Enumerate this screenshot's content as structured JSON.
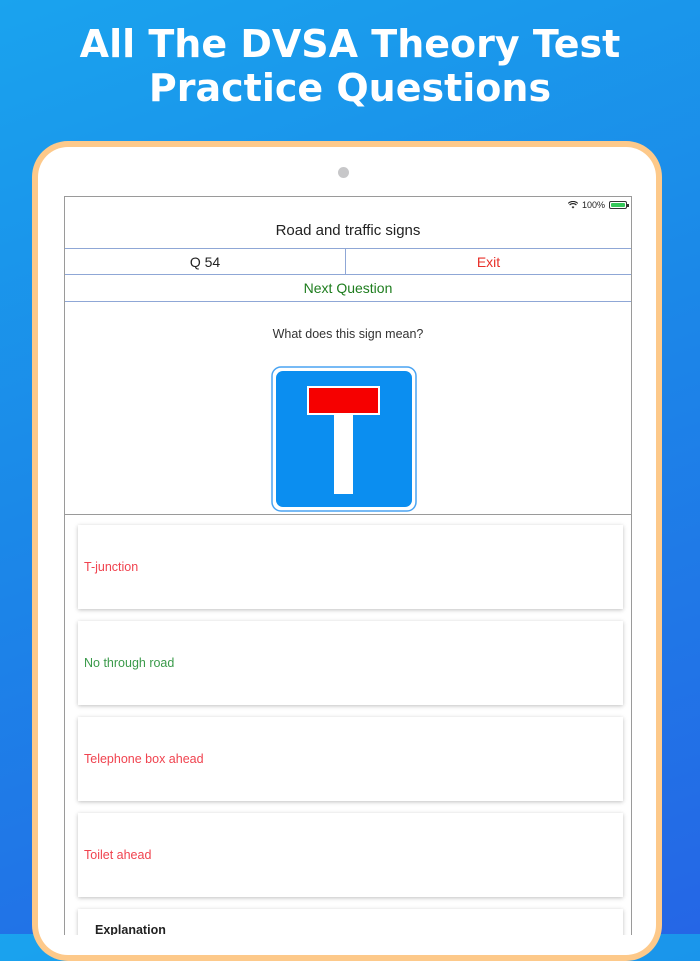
{
  "headline": {
    "line1": "All The DVSA Theory Test",
    "line2": "Practice Questions"
  },
  "status_bar": {
    "battery": "100%",
    "battery_level": 1.0,
    "icons": [
      "wifi-icon",
      "battery-icon"
    ]
  },
  "header": {
    "title": "Road and traffic signs",
    "question_number": "Q 54",
    "exit_label": "Exit",
    "next_label": "Next Question"
  },
  "question": {
    "text": "What does this sign mean?",
    "sign_icon": "no-through-road-sign-icon"
  },
  "answers": [
    {
      "label": "T-junction",
      "state": "wrong"
    },
    {
      "label": "No through road",
      "state": "correct"
    },
    {
      "label": "Telephone box ahead",
      "state": "wrong"
    },
    {
      "label": "Toilet ahead",
      "state": "wrong"
    }
  ],
  "explanation": {
    "heading": "Explanation"
  },
  "colors": {
    "background_top": "#1aa3ee",
    "background_bottom": "#2566e6",
    "tablet_frame": "#fdc98a",
    "wrong": "#f0434f",
    "correct": "#3a9a4a",
    "exit": "#e8302a",
    "next": "#1e7d1e",
    "sign_blue": "#0b8ef0",
    "sign_red": "#f60000"
  }
}
